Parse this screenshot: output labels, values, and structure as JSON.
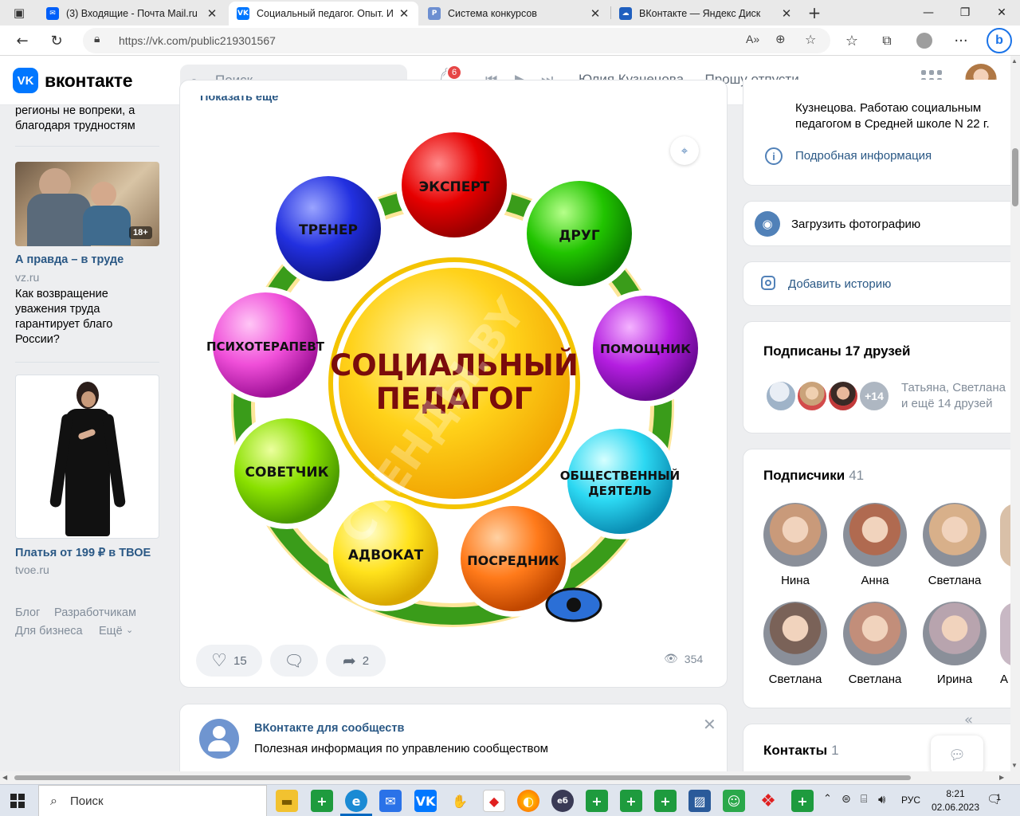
{
  "browser": {
    "tabs": [
      {
        "title": "(3) Входящие - Почта Mail.ru",
        "favicon": "mail-icon",
        "color": "#005ff9"
      },
      {
        "title": "Социальный педагог. Опыт. Ид",
        "favicon": "vk-icon",
        "color": "#0077ff"
      },
      {
        "title": "Система конкурсов",
        "favicon": "contest-icon",
        "color": "#6d8fd1"
      },
      {
        "title": "ВКонтакте — Яндекс Диск",
        "favicon": "yandex-disk-icon",
        "color": "#1f5fbf"
      }
    ],
    "url": "https://vk.com/public219301567"
  },
  "vk_header": {
    "logo_text": "вконтакте",
    "logo_badge": "VK",
    "search_placeholder": "Поиск",
    "notification_count": "6",
    "now_playing": "Юлия Кузнецова — Прошу отпусти"
  },
  "left_column": {
    "prev_ad_tail": "регионы не вопреки, а благодаря трудностям",
    "ad1": {
      "title": "А правда – в труде",
      "domain": "vz.ru",
      "text": "Как возвращение уважения труда гарантирует благо России?",
      "age_badge": "18+"
    },
    "ad2": {
      "title": "Платья от 199 ₽ в ТВОЕ",
      "domain": "tvoe.ru"
    },
    "footer": {
      "blog": "Блог",
      "developers": "Разработчикам",
      "business": "Для бизнеса",
      "more": "Ещё"
    }
  },
  "post": {
    "show_more": "Показать еще",
    "image": {
      "center_line1": "СОЦИАЛЬНЫЙ",
      "center_line2": "ПЕДАГОГ",
      "roles": [
        "ЭКСПЕРТ",
        "ДРУГ",
        "ТРЕНЕР",
        "ПСИХОТЕРАПЕВТ",
        "ПОМОЩНИК",
        "СОВЕТЧИК",
        "ОБЩЕСТВЕННЫЙ",
        "ДЕЯТЕЛЬ",
        "АДВОКАТ",
        "ПОСРЕДНИК"
      ],
      "watermark": "СТЕНДЫ.BY"
    },
    "likes": "15",
    "reposts": "2",
    "views": "354"
  },
  "community_card": {
    "title": "ВКонтакте для сообществ",
    "text": "Полезная информация по управлению сообществом"
  },
  "right_column": {
    "info_line1": "Кузнецова. Работаю социальным",
    "info_line2": "педагогом в Средней школе N 22 г.",
    "details_link": "Подробная информация",
    "upload_photo": "Загрузить фотографию",
    "add_story": "Добавить историю",
    "friends": {
      "title": "Подписаны 17 друзей",
      "more_badge": "+14",
      "names_line1": "Татьяна, Светлана",
      "names_line2": "и ещё 14 друзей"
    },
    "subscribers": {
      "title": "Подписчики",
      "count": "41",
      "people": [
        {
          "name": "Нина",
          "color": "#c99a7a"
        },
        {
          "name": "Анна",
          "color": "#b06a50"
        },
        {
          "name": "Светлана",
          "color": "#d8b08a"
        },
        {
          "name": "Светлана",
          "color": "#7a6258"
        },
        {
          "name": "Светлана",
          "color": "#c28e7a"
        },
        {
          "name": "Ирина",
          "color": "#b8a4ae"
        }
      ],
      "partial_name": "А"
    },
    "contacts": {
      "title": "Контакты",
      "count": "1"
    }
  },
  "taskbar": {
    "search_label": "Поиск",
    "lang": "РУС",
    "time": "8:21",
    "date": "02.06.2023",
    "notification_count": "1"
  }
}
